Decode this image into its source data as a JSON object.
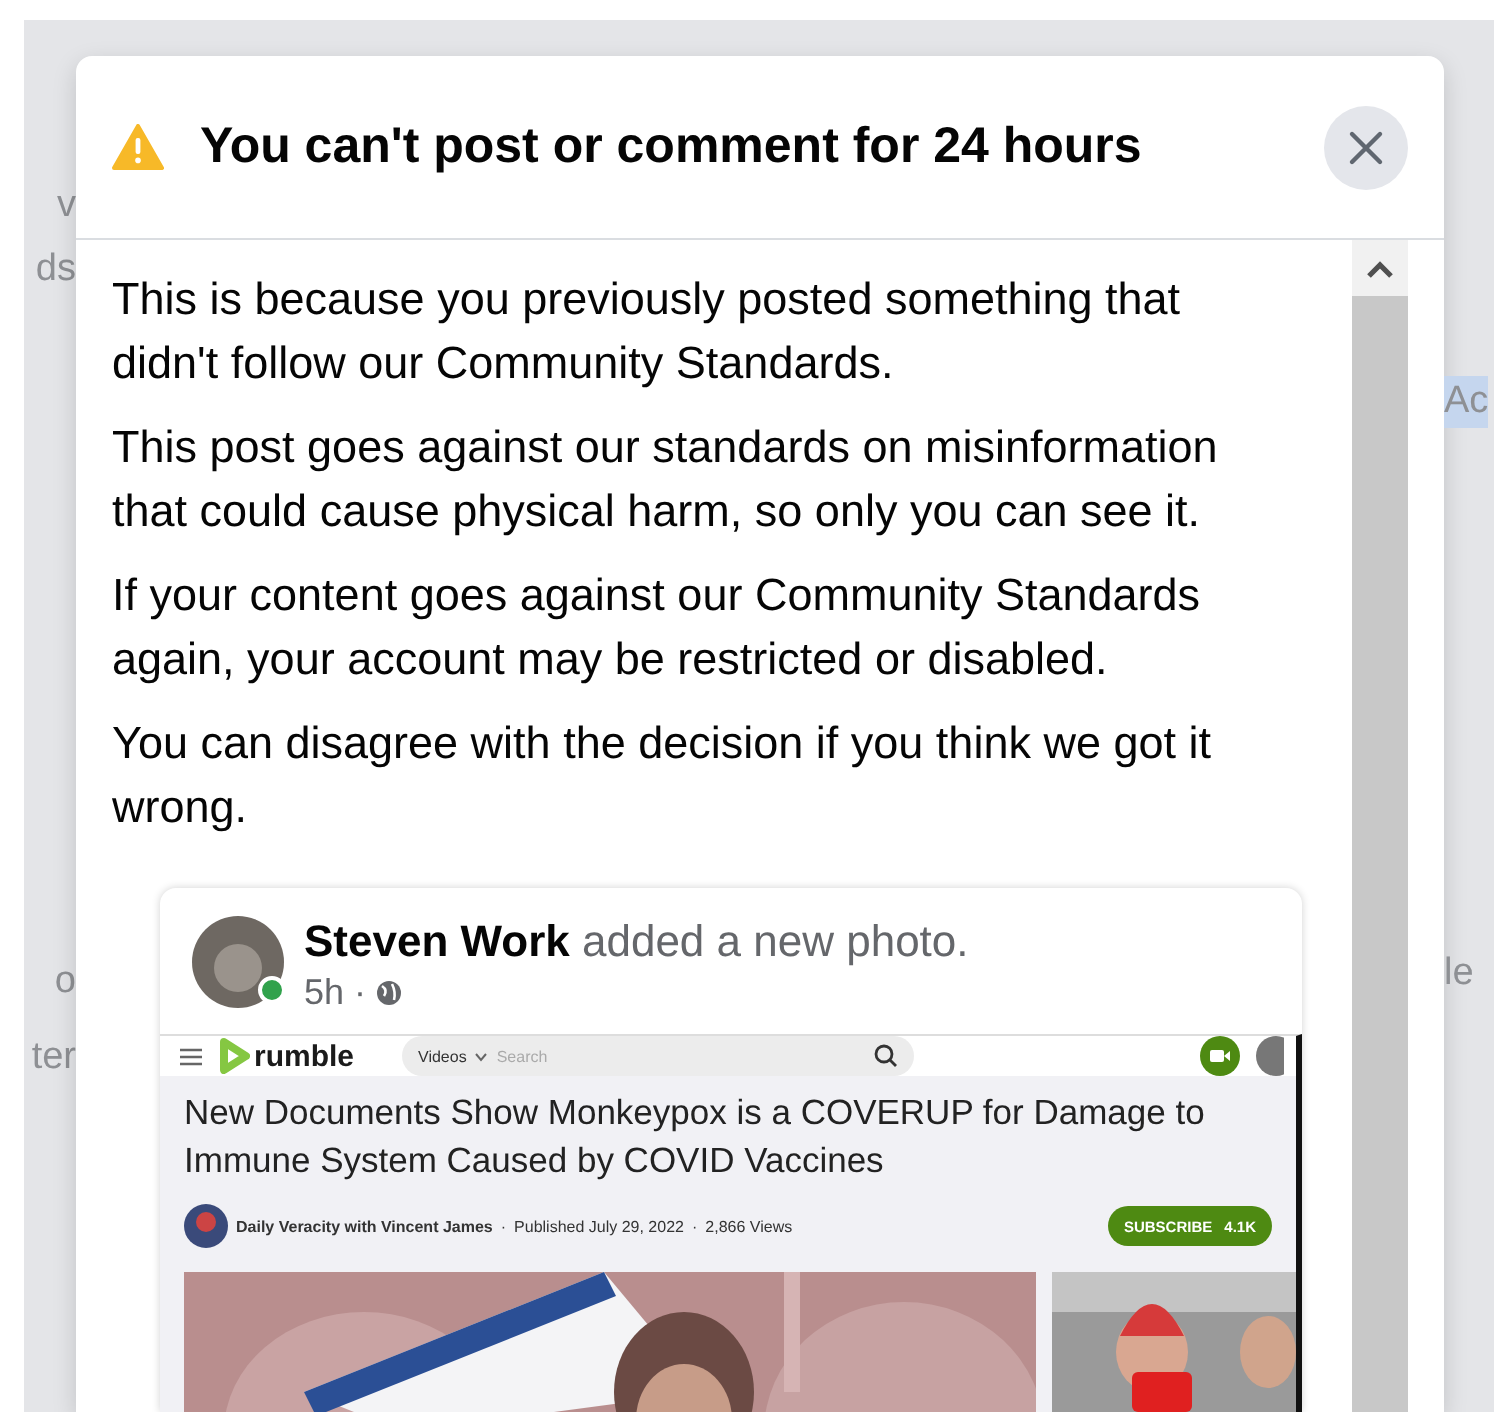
{
  "background": {
    "left_texts": [
      "v",
      "ds",
      "o",
      "ter"
    ],
    "right_texts": [
      "Ac",
      "le"
    ]
  },
  "dialog": {
    "title": "You can't post or comment for 24 hours",
    "paragraphs": [
      "This is because you previously posted something that didn't follow our Community Standards.",
      "This post goes against our standards on misinformation that could cause physical harm, so only you can see it.",
      "If your content goes against our Community Standards again, your account may be restricted or disabled.",
      "You can disagree with the decision if you think we got it wrong."
    ],
    "post": {
      "author": "Steven Work",
      "action": "added a new photo.",
      "time": "5h ·",
      "online": true,
      "shared_page": {
        "site": "rumble",
        "search_category": "Videos",
        "search_placeholder": "Search",
        "video_title": "New Documents Show Monkeypox is a COVERUP for Damage to Immune System Caused by COVID Vaccines",
        "meta": [
          "Daily Veracity with Vincent James",
          "Published July 29, 2022",
          "2,866 Views"
        ],
        "separator": "·",
        "subscribe": "SUBSCRIBE",
        "subscribers": "4.1K"
      }
    }
  }
}
